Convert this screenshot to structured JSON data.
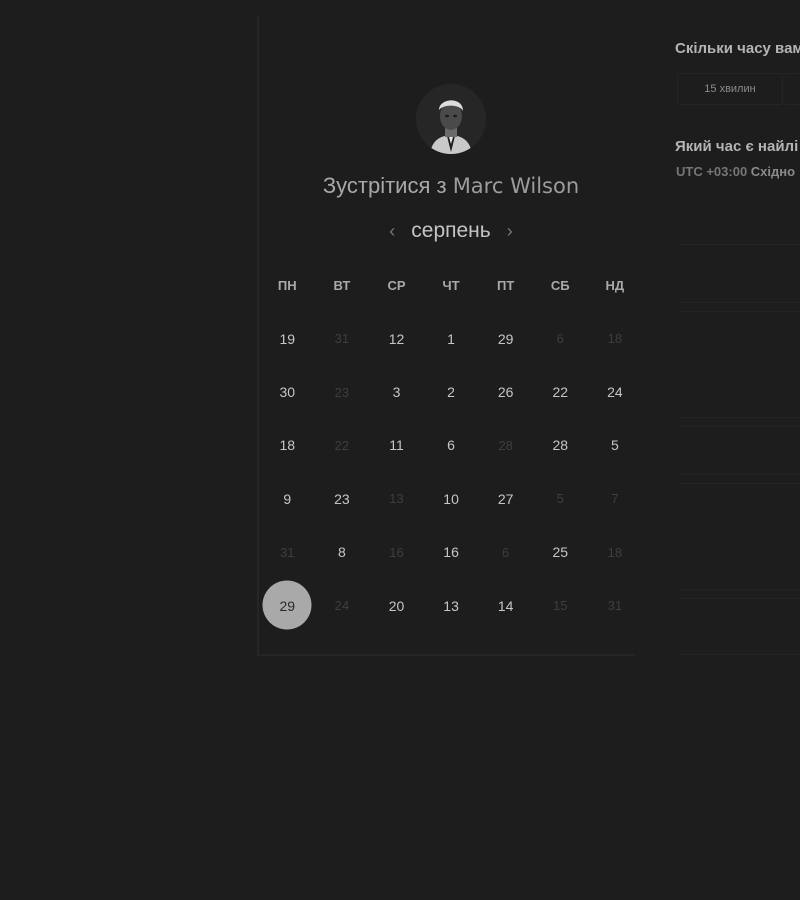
{
  "header": {
    "title_prefix": "Зустрітися з",
    "host_name": "Marc Wilson"
  },
  "calendar": {
    "month": "серпень",
    "prev_icon": "chevron-left-icon",
    "next_icon": "chevron-right-icon",
    "weekdays": [
      "ПН",
      "ВТ",
      "СР",
      "ЧТ",
      "ПТ",
      "СБ",
      "НД"
    ],
    "weeks": [
      [
        {
          "v": "19",
          "dim": false
        },
        {
          "v": "31",
          "dim": true
        },
        {
          "v": "12",
          "dim": false
        },
        {
          "v": "1",
          "dim": false
        },
        {
          "v": "29",
          "dim": false
        },
        {
          "v": "6",
          "dim": true
        },
        {
          "v": "18",
          "dim": true
        }
      ],
      [
        {
          "v": "30",
          "dim": false
        },
        {
          "v": "23",
          "dim": true
        },
        {
          "v": "3",
          "dim": false
        },
        {
          "v": "2",
          "dim": false
        },
        {
          "v": "26",
          "dim": false
        },
        {
          "v": "22",
          "dim": false
        },
        {
          "v": "24",
          "dim": false
        }
      ],
      [
        {
          "v": "18",
          "dim": false
        },
        {
          "v": "22",
          "dim": true
        },
        {
          "v": "11",
          "dim": false
        },
        {
          "v": "6",
          "dim": false
        },
        {
          "v": "28",
          "dim": true
        },
        {
          "v": "28",
          "dim": false
        },
        {
          "v": "5",
          "dim": false
        }
      ],
      [
        {
          "v": "9",
          "dim": false
        },
        {
          "v": "23",
          "dim": false
        },
        {
          "v": "13",
          "dim": true
        },
        {
          "v": "10",
          "dim": false
        },
        {
          "v": "27",
          "dim": false
        },
        {
          "v": "5",
          "dim": true
        },
        {
          "v": "7",
          "dim": true
        }
      ],
      [
        {
          "v": "31",
          "dim": true
        },
        {
          "v": "8",
          "dim": false
        },
        {
          "v": "16",
          "dim": true
        },
        {
          "v": "16",
          "dim": false
        },
        {
          "v": "6",
          "dim": true
        },
        {
          "v": "25",
          "dim": false
        },
        {
          "v": "18",
          "dim": true
        }
      ],
      [
        {
          "v": "29",
          "dim": false,
          "selected": true
        },
        {
          "v": "24",
          "dim": true
        },
        {
          "v": "20",
          "dim": false
        },
        {
          "v": "13",
          "dim": false
        },
        {
          "v": "14",
          "dim": false
        },
        {
          "v": "15",
          "dim": true
        },
        {
          "v": "31",
          "dim": true
        }
      ]
    ]
  },
  "right_panel": {
    "duration_question": "Скільки часу вам",
    "duration_option": "15 хвилин",
    "time_question": "Який час є найлі",
    "timezone_offset": "UTC +03:00",
    "timezone_name": "Східно"
  },
  "colors": {
    "background": "#1d1d1d",
    "selected_day": "#a9a9a9"
  }
}
